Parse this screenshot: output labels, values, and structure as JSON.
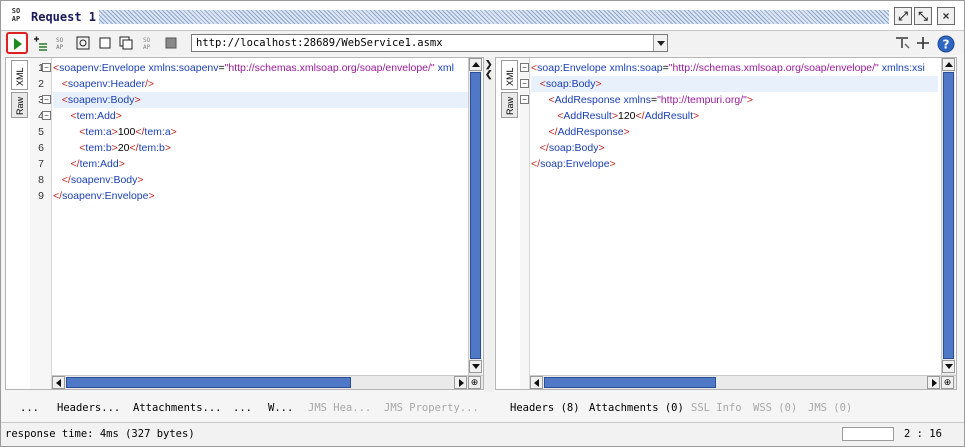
{
  "window": {
    "title": "Request 1"
  },
  "title_buttons": {
    "detach": "⤢",
    "maximize": "⤡",
    "close": "×"
  },
  "toolbar": {
    "endpoint_url": "http://localhost:28689/WebService1.asmx"
  },
  "request": {
    "tabs": [
      "XML",
      "Raw"
    ],
    "lines": [
      {
        "n": "1",
        "parts": [
          [
            "brk",
            "<"
          ],
          [
            "tag",
            "soapenv:Envelope"
          ],
          [
            "txt",
            " "
          ],
          [
            "attr",
            "xmlns:soapenv"
          ],
          [
            "txt",
            "="
          ],
          [
            "aval",
            "\"http://schemas.xmlsoap.org/soap/envelope/\""
          ],
          [
            "txt",
            " "
          ],
          [
            "attr",
            "xml"
          ]
        ]
      },
      {
        "n": "2",
        "parts": [
          [
            "txt",
            "   "
          ],
          [
            "brk",
            "<"
          ],
          [
            "tag",
            "soapenv:Header"
          ],
          [
            "brk",
            "/>"
          ]
        ]
      },
      {
        "n": "3",
        "parts": [
          [
            "txt",
            "   "
          ],
          [
            "brk",
            "<"
          ],
          [
            "tag",
            "soapenv:Body"
          ],
          [
            "brk",
            ">"
          ]
        ]
      },
      {
        "n": "4",
        "parts": [
          [
            "txt",
            "      "
          ],
          [
            "brk",
            "<"
          ],
          [
            "tag",
            "tem:Add"
          ],
          [
            "brk",
            ">"
          ]
        ]
      },
      {
        "n": "5",
        "parts": [
          [
            "txt",
            "         "
          ],
          [
            "brk",
            "<"
          ],
          [
            "tag",
            "tem:a"
          ],
          [
            "brk",
            ">"
          ],
          [
            "txt",
            "100"
          ],
          [
            "brk",
            "</"
          ],
          [
            "tag",
            "tem:a"
          ],
          [
            "brk",
            ">"
          ]
        ]
      },
      {
        "n": "6",
        "parts": [
          [
            "txt",
            "         "
          ],
          [
            "brk",
            "<"
          ],
          [
            "tag",
            "tem:b"
          ],
          [
            "brk",
            ">"
          ],
          [
            "txt",
            "20"
          ],
          [
            "brk",
            "</"
          ],
          [
            "tag",
            "tem:b"
          ],
          [
            "brk",
            ">"
          ]
        ]
      },
      {
        "n": "7",
        "parts": [
          [
            "txt",
            "      "
          ],
          [
            "brk",
            "</"
          ],
          [
            "tag",
            "tem:Add"
          ],
          [
            "brk",
            ">"
          ]
        ]
      },
      {
        "n": "8",
        "parts": [
          [
            "txt",
            "   "
          ],
          [
            "brk",
            "</"
          ],
          [
            "tag",
            "soapenv:Body"
          ],
          [
            "brk",
            ">"
          ]
        ]
      },
      {
        "n": "9",
        "parts": [
          [
            "brk",
            "</"
          ],
          [
            "tag",
            "soapenv:Envelope"
          ],
          [
            "brk",
            ">"
          ]
        ]
      }
    ],
    "bottom_tabs": [
      {
        "label": "...",
        "dim": false
      },
      {
        "label": "Headers...",
        "dim": false
      },
      {
        "label": "Attachments...",
        "dim": false
      },
      {
        "label": "...",
        "dim": false
      },
      {
        "label": "W...",
        "dim": false
      },
      {
        "label": "JMS Hea...",
        "dim": true
      },
      {
        "label": "JMS Property...",
        "dim": true
      }
    ]
  },
  "response": {
    "tabs": [
      "XML",
      "Raw"
    ],
    "lines": [
      {
        "parts": [
          [
            "brk",
            "<"
          ],
          [
            "tag",
            "soap:Envelope"
          ],
          [
            "txt",
            " "
          ],
          [
            "attr",
            "xmlns:soap"
          ],
          [
            "txt",
            "="
          ],
          [
            "aval",
            "\"http://schemas.xmlsoap.org/soap/envelope/\""
          ],
          [
            "txt",
            " "
          ],
          [
            "attr",
            "xmlns:xsi"
          ]
        ]
      },
      {
        "parts": [
          [
            "txt",
            "   "
          ],
          [
            "brk",
            "<"
          ],
          [
            "tag",
            "soap:Body"
          ],
          [
            "brk",
            ">"
          ]
        ]
      },
      {
        "parts": [
          [
            "txt",
            "      "
          ],
          [
            "brk",
            "<"
          ],
          [
            "tag",
            "AddResponse"
          ],
          [
            "txt",
            " "
          ],
          [
            "attr",
            "xmlns"
          ],
          [
            "txt",
            "="
          ],
          [
            "aval",
            "\"http://tempuri.org/\""
          ],
          [
            "brk",
            ">"
          ]
        ]
      },
      {
        "parts": [
          [
            "txt",
            "         "
          ],
          [
            "brk",
            "<"
          ],
          [
            "tag",
            "AddResult"
          ],
          [
            "brk",
            ">"
          ],
          [
            "txt",
            "120"
          ],
          [
            "brk",
            "</"
          ],
          [
            "tag",
            "AddResult"
          ],
          [
            "brk",
            ">"
          ]
        ]
      },
      {
        "parts": [
          [
            "txt",
            "      "
          ],
          [
            "brk",
            "</"
          ],
          [
            "tag",
            "AddResponse"
          ],
          [
            "brk",
            ">"
          ]
        ]
      },
      {
        "parts": [
          [
            "txt",
            "   "
          ],
          [
            "brk",
            "</"
          ],
          [
            "tag",
            "soap:Body"
          ],
          [
            "brk",
            ">"
          ]
        ]
      },
      {
        "parts": [
          [
            "brk",
            "</"
          ],
          [
            "tag",
            "soap:Envelope"
          ],
          [
            "brk",
            ">"
          ]
        ]
      }
    ],
    "bottom_tabs": [
      {
        "label": "Headers (8)",
        "dim": false
      },
      {
        "label": "Attachments (0)",
        "dim": false
      },
      {
        "label": "SSL Info",
        "dim": true
      },
      {
        "label": "WSS (0)",
        "dim": true
      },
      {
        "label": "JMS (0)",
        "dim": true
      }
    ]
  },
  "status": {
    "response_time": "response time: 4ms (327 bytes)",
    "cursor_position": "2 : 16"
  },
  "colors": {
    "tag": "#1a3fb5",
    "bracket": "#c2201a",
    "attr_value": "#9a1a9a",
    "run_highlight": "#e02020",
    "scroll_thumb": "#4f79c7"
  }
}
